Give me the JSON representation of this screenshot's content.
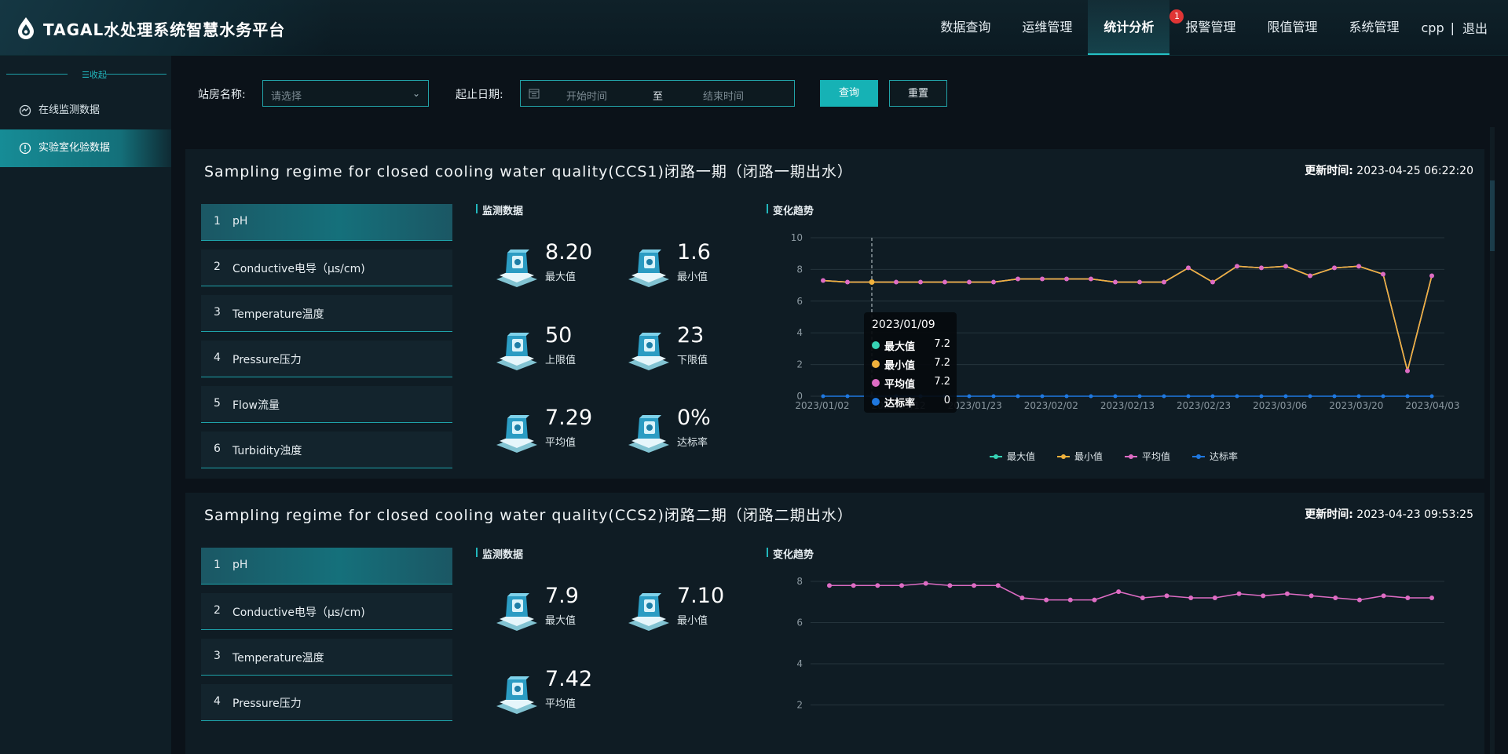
{
  "header": {
    "title": "TAGAL水处理系统智慧水务平台",
    "nav": [
      {
        "label": "数据查询",
        "active": false
      },
      {
        "label": "运维管理",
        "active": false
      },
      {
        "label": "统计分析",
        "active": true
      },
      {
        "label": "报警管理",
        "active": false,
        "badge": "1"
      },
      {
        "label": "限值管理",
        "active": false
      },
      {
        "label": "系统管理",
        "active": false
      }
    ],
    "user": "cpp",
    "separator": "|",
    "logout": "退出"
  },
  "sidebar": {
    "collapse_label": "☰收起",
    "items": [
      {
        "label": "在线监测数据",
        "icon": "online-monitor-icon",
        "active": false
      },
      {
        "label": "实验室化验数据",
        "icon": "lab-alert-icon",
        "active": true
      }
    ]
  },
  "filter": {
    "station_label": "站房名称:",
    "station_placeholder": "请选择",
    "date_label": "起止日期:",
    "start_placeholder": "开始时间",
    "to_label": "至",
    "end_placeholder": "结束时间",
    "query_button": "查询",
    "reset_button": "重置"
  },
  "colors": {
    "accent": "#16b2b5",
    "max": "#36d3b5",
    "min": "#f0b13c",
    "avg": "#de6cc4",
    "rate": "#1f78e0"
  },
  "sections": [
    {
      "title": "Sampling regime for closed cooling water quality(CCS1)闭路一期（闭路一期出水）",
      "update_label": "更新时间:",
      "update_time": "2023-04-25 06:22:20",
      "params": [
        {
          "num": "1",
          "label": "pH",
          "active": true
        },
        {
          "num": "2",
          "label": "Conductive电导（μs/cm)",
          "active": false
        },
        {
          "num": "3",
          "label": "Temperature温度",
          "active": false
        },
        {
          "num": "4",
          "label": "Pressure压力",
          "active": false
        },
        {
          "num": "5",
          "label": "Flow流量",
          "active": false
        },
        {
          "num": "6",
          "label": "Turbidity浊度",
          "active": false
        }
      ],
      "monitor_heading": "监测数据",
      "trend_heading": "变化趋势",
      "metrics": [
        {
          "value": "8.20",
          "label": "最大值",
          "icon": "max-value-icon"
        },
        {
          "value": "1.6",
          "label": "最小值",
          "icon": "min-value-icon"
        },
        {
          "value": "50",
          "label": "上限值",
          "icon": "upper-limit-icon"
        },
        {
          "value": "23",
          "label": "下限值",
          "icon": "lower-limit-icon"
        },
        {
          "value": "7.29",
          "label": "平均值",
          "icon": "average-icon"
        },
        {
          "value": "0%",
          "label": "达标率",
          "icon": "compliance-rate-icon"
        }
      ],
      "tooltip": {
        "date": "2023/01/09",
        "rows": [
          {
            "name": "最大值",
            "value": "7.2",
            "color": "#36d3b5"
          },
          {
            "name": "最小值",
            "value": "7.2",
            "color": "#f0b13c"
          },
          {
            "name": "平均值",
            "value": "7.2",
            "color": "#de6cc4"
          },
          {
            "name": "达标率",
            "value": "0",
            "color": "#1f78e0"
          }
        ]
      },
      "legend": [
        {
          "name": "最大值",
          "color": "#36d3b5"
        },
        {
          "name": "最小值",
          "color": "#f0b13c"
        },
        {
          "name": "平均值",
          "color": "#de6cc4"
        },
        {
          "name": "达标率",
          "color": "#1f78e0"
        }
      ]
    },
    {
      "title": "Sampling regime for closed cooling water quality(CCS2)闭路二期（闭路二期出水）",
      "update_label": "更新时间:",
      "update_time": "2023-04-23 09:53:25",
      "params": [
        {
          "num": "1",
          "label": "pH",
          "active": true
        },
        {
          "num": "2",
          "label": "Conductive电导（μs/cm)",
          "active": false
        },
        {
          "num": "3",
          "label": "Temperature温度",
          "active": false
        },
        {
          "num": "4",
          "label": "Pressure压力",
          "active": false
        }
      ],
      "monitor_heading": "监测数据",
      "trend_heading": "变化趋势",
      "metrics": [
        {
          "value": "7.9",
          "label": "最大值",
          "icon": "max-value-icon"
        },
        {
          "value": "7.10",
          "label": "最小值",
          "icon": "min-value-icon"
        },
        {
          "value": "7.42",
          "label": "平均值",
          "icon": "average-icon"
        }
      ]
    }
  ],
  "chart_data": [
    {
      "type": "line",
      "ylim": [
        0,
        10
      ],
      "yticks": [
        0,
        2,
        4,
        6,
        8,
        10
      ],
      "x_tick_labels": [
        "2023/01/02",
        "2023/01/12",
        "2023/01/23",
        "2023/02/02",
        "2023/02/13",
        "2023/02/23",
        "2023/03/06",
        "2023/03/20",
        "2023/04/03"
      ],
      "series": [
        {
          "name": "最大值",
          "values": [
            7.3,
            7.2,
            7.2,
            7.2,
            7.2,
            7.2,
            7.2,
            7.2,
            7.4,
            7.4,
            7.4,
            7.4,
            7.2,
            7.2,
            7.2,
            8.1,
            7.2,
            8.2,
            8.1,
            8.2,
            7.6,
            8.1,
            8.2,
            7.7,
            1.6,
            7.6
          ]
        },
        {
          "name": "最小值",
          "values": [
            7.3,
            7.2,
            7.2,
            7.2,
            7.2,
            7.2,
            7.2,
            7.2,
            7.4,
            7.4,
            7.4,
            7.4,
            7.2,
            7.2,
            7.2,
            8.1,
            7.2,
            8.2,
            8.1,
            8.2,
            7.6,
            8.1,
            8.2,
            7.7,
            1.6,
            7.6
          ]
        },
        {
          "name": "平均值",
          "values": [
            7.3,
            7.2,
            7.2,
            7.2,
            7.2,
            7.2,
            7.2,
            7.2,
            7.4,
            7.4,
            7.4,
            7.4,
            7.2,
            7.2,
            7.2,
            8.1,
            7.2,
            8.2,
            8.1,
            8.2,
            7.6,
            8.1,
            8.2,
            7.7,
            1.6,
            7.6
          ]
        },
        {
          "name": "达标率",
          "values": [
            0,
            0,
            0,
            0,
            0,
            0,
            0,
            0,
            0,
            0,
            0,
            0,
            0,
            0,
            0,
            0,
            0,
            0,
            0,
            0,
            0,
            0,
            0,
            0,
            0,
            0
          ]
        }
      ]
    },
    {
      "type": "line",
      "yticks": [
        2,
        4,
        6,
        8
      ],
      "series": [
        {
          "name": "平均值",
          "values": [
            7.8,
            7.8,
            7.8,
            7.8,
            7.9,
            7.8,
            7.8,
            7.8,
            7.2,
            7.1,
            7.1,
            7.1,
            7.5,
            7.2,
            7.3,
            7.2,
            7.2,
            7.4,
            7.3,
            7.4,
            7.3,
            7.2,
            7.1,
            7.3,
            7.2,
            7.2
          ]
        }
      ]
    }
  ]
}
